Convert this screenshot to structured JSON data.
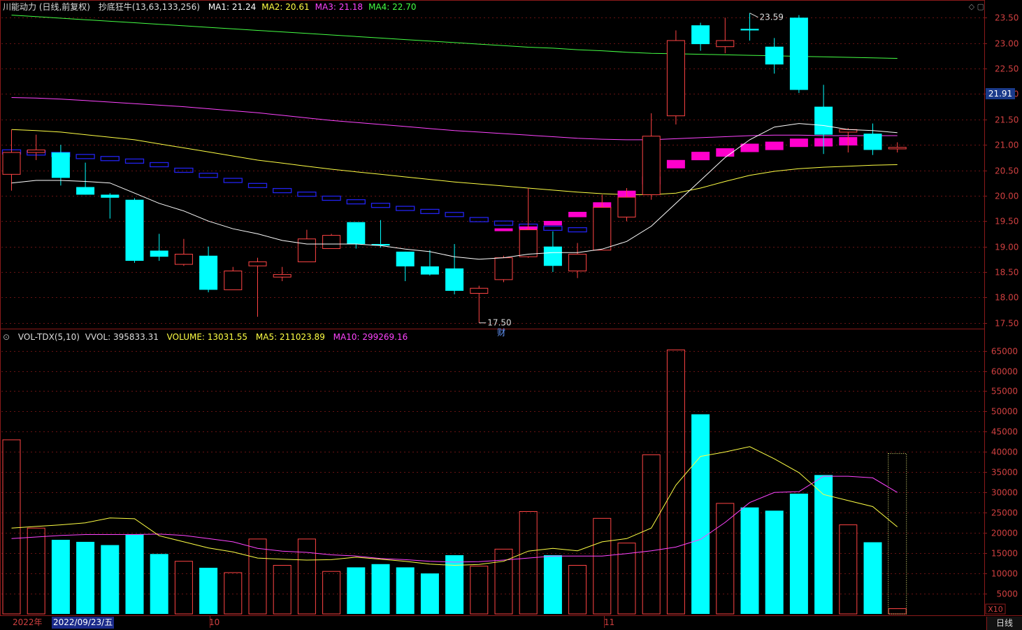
{
  "header": {
    "title": "川能动力 (日线,前复权)",
    "indicator": "抄底狂牛(13,63,133,256)",
    "ma_labels": [
      {
        "text": "MA1: 21.24",
        "color": "#ffffff"
      },
      {
        "text": "MA2: 20.61",
        "color": "#ffff44"
      },
      {
        "text": "MA3: 21.18",
        "color": "#ff44ff"
      },
      {
        "text": "MA4: 22.70",
        "color": "#44ff44"
      }
    ]
  },
  "volume_header": {
    "indicator": "VOL-TDX(5,10)",
    "vvol": "VVOL: 395833.31",
    "volume": "VOLUME: 13031.55",
    "ma5": "MA5: 211023.89",
    "ma10": "MA10: 299269.16"
  },
  "current_price": "21.91",
  "annotations": {
    "high": "23.59",
    "low": "17.50",
    "event": "财"
  },
  "x_labels": {
    "year": "2022年",
    "cursor_date": "2022/09/23/五",
    "oct": "10",
    "nov": "11",
    "period": "日线"
  },
  "vol_scale_tag": "X10",
  "colors": {
    "up": "#ff4444",
    "down": "#00ffff",
    "ma1": "#ffffff",
    "ma2": "#ffff44",
    "ma3": "#ff44ff",
    "ma4": "#44ff44",
    "blue_steps": "#2222ee",
    "magenta_steps": "#ff00cc",
    "grid": "#8b1a1a"
  },
  "chart_data": {
    "type": "candlestick",
    "price_axis": {
      "ticks": [
        17.5,
        18.0,
        18.5,
        19.0,
        19.5,
        20.0,
        20.5,
        21.0,
        21.5,
        22.0,
        22.5,
        23.0,
        23.5
      ],
      "range": [
        17.4,
        23.6
      ]
    },
    "volume_axis": {
      "ticks": [
        5000,
        10000,
        15000,
        20000,
        25000,
        30000,
        35000,
        40000,
        45000,
        50000,
        55000,
        60000,
        65000
      ],
      "range": [
        0,
        67000
      ]
    },
    "candles": [
      {
        "o": 20.42,
        "h": 21.3,
        "l": 20.1,
        "c": 20.85,
        "v": 43000
      },
      {
        "o": 20.85,
        "h": 21.2,
        "l": 20.7,
        "c": 20.9,
        "v": 21200
      },
      {
        "o": 20.85,
        "h": 21.0,
        "l": 20.2,
        "c": 20.35,
        "v": 18300
      },
      {
        "o": 20.17,
        "h": 20.65,
        "l": 20.02,
        "c": 20.02,
        "v": 17800
      },
      {
        "o": 20.02,
        "h": 20.05,
        "l": 19.55,
        "c": 19.96,
        "v": 17000
      },
      {
        "o": 19.92,
        "h": 19.95,
        "l": 18.68,
        "c": 18.72,
        "v": 19700
      },
      {
        "o": 18.92,
        "h": 19.25,
        "l": 18.72,
        "c": 18.8,
        "v": 14800
      },
      {
        "o": 18.65,
        "h": 19.15,
        "l": 18.62,
        "c": 18.85,
        "v": 13000
      },
      {
        "o": 18.82,
        "h": 19.0,
        "l": 18.1,
        "c": 18.15,
        "v": 11400
      },
      {
        "o": 18.15,
        "h": 18.6,
        "l": 18.15,
        "c": 18.52,
        "v": 10200
      },
      {
        "o": 18.62,
        "h": 18.78,
        "l": 17.62,
        "c": 18.7,
        "v": 18500
      },
      {
        "o": 18.4,
        "h": 18.6,
        "l": 18.32,
        "c": 18.45,
        "v": 12000
      },
      {
        "o": 18.7,
        "h": 19.33,
        "l": 18.7,
        "c": 19.15,
        "v": 18500
      },
      {
        "o": 18.96,
        "h": 19.25,
        "l": 18.96,
        "c": 19.22,
        "v": 10500
      },
      {
        "o": 19.48,
        "h": 19.48,
        "l": 18.96,
        "c": 19.05,
        "v": 11500
      },
      {
        "o": 19.05,
        "h": 19.52,
        "l": 18.98,
        "c": 19.02,
        "v": 12300
      },
      {
        "o": 18.9,
        "h": 18.9,
        "l": 18.32,
        "c": 18.61,
        "v": 11500
      },
      {
        "o": 18.61,
        "h": 18.93,
        "l": 18.43,
        "c": 18.45,
        "v": 10000
      },
      {
        "o": 18.57,
        "h": 19.05,
        "l": 18.06,
        "c": 18.13,
        "v": 14500
      },
      {
        "o": 18.08,
        "h": 18.23,
        "l": 17.5,
        "c": 18.18,
        "v": 11800
      },
      {
        "o": 18.35,
        "h": 18.82,
        "l": 18.3,
        "c": 18.78,
        "v": 16000
      },
      {
        "o": 18.8,
        "h": 20.15,
        "l": 18.78,
        "c": 19.33,
        "v": 25300
      },
      {
        "o": 19.0,
        "h": 19.3,
        "l": 18.5,
        "c": 18.62,
        "v": 14500
      },
      {
        "o": 18.52,
        "h": 19.07,
        "l": 18.38,
        "c": 18.85,
        "v": 12000
      },
      {
        "o": 18.93,
        "h": 20.02,
        "l": 18.93,
        "c": 19.77,
        "v": 23600
      },
      {
        "o": 19.58,
        "h": 20.15,
        "l": 19.5,
        "c": 19.97,
        "v": 17500
      },
      {
        "o": 20.02,
        "h": 21.62,
        "l": 19.92,
        "c": 21.17,
        "v": 39300
      },
      {
        "o": 21.57,
        "h": 23.25,
        "l": 21.4,
        "c": 23.05,
        "v": 65200
      },
      {
        "o": 23.35,
        "h": 23.4,
        "l": 22.85,
        "c": 22.98,
        "v": 49300
      },
      {
        "o": 22.93,
        "h": 23.5,
        "l": 22.8,
        "c": 23.05,
        "v": 27300
      },
      {
        "o": 23.28,
        "h": 23.59,
        "l": 23.05,
        "c": 23.25,
        "v": 26300
      },
      {
        "o": 22.93,
        "h": 23.1,
        "l": 22.4,
        "c": 22.58,
        "v": 25500
      },
      {
        "o": 23.5,
        "h": 23.55,
        "l": 22.02,
        "c": 22.08,
        "v": 29700
      },
      {
        "o": 21.75,
        "h": 22.18,
        "l": 20.82,
        "c": 21.2,
        "v": 34300
      },
      {
        "o": 21.25,
        "h": 21.33,
        "l": 20.85,
        "c": 21.3,
        "v": 22000
      },
      {
        "o": 21.22,
        "h": 21.42,
        "l": 20.8,
        "c": 20.9,
        "v": 17700
      },
      {
        "o": 20.92,
        "h": 21.05,
        "l": 20.85,
        "c": 20.95,
        "v": 1300
      }
    ],
    "ma1_line": [
      20.25,
      20.3,
      20.3,
      20.28,
      20.25,
      20.05,
      19.85,
      19.7,
      19.5,
      19.35,
      19.25,
      19.12,
      19.05,
      19.05,
      19.05,
      19.02,
      18.95,
      18.9,
      18.8,
      18.75,
      18.78,
      18.85,
      18.88,
      18.88,
      18.95,
      19.1,
      19.4,
      19.85,
      20.3,
      20.75,
      21.1,
      21.35,
      21.42,
      21.38,
      21.3,
      21.28,
      21.24
    ],
    "ma2_line": [
      21.3,
      21.28,
      21.25,
      21.2,
      21.15,
      21.1,
      21.02,
      20.94,
      20.86,
      20.78,
      20.7,
      20.64,
      20.58,
      20.52,
      20.47,
      20.42,
      20.37,
      20.32,
      20.27,
      20.23,
      20.19,
      20.15,
      20.11,
      20.07,
      20.04,
      20.02,
      20.02,
      20.05,
      20.15,
      20.28,
      20.4,
      20.48,
      20.53,
      20.56,
      20.58,
      20.6,
      20.61
    ],
    "ma3_line": [
      21.93,
      21.92,
      21.9,
      21.87,
      21.84,
      21.81,
      21.78,
      21.75,
      21.71,
      21.67,
      21.63,
      21.58,
      21.53,
      21.48,
      21.44,
      21.4,
      21.36,
      21.32,
      21.28,
      21.25,
      21.22,
      21.19,
      21.16,
      21.13,
      21.11,
      21.1,
      21.1,
      21.12,
      21.14,
      21.16,
      21.18,
      21.19,
      21.19,
      21.18,
      21.18,
      21.18,
      21.18
    ],
    "ma4_line": [
      23.55,
      23.52,
      23.49,
      23.46,
      23.43,
      23.4,
      23.37,
      23.34,
      23.31,
      23.28,
      23.25,
      23.22,
      23.19,
      23.16,
      23.13,
      23.1,
      23.07,
      23.04,
      23.01,
      22.98,
      22.95,
      22.92,
      22.9,
      22.87,
      22.85,
      22.82,
      22.8,
      22.79,
      22.78,
      22.77,
      22.76,
      22.75,
      22.74,
      22.73,
      22.72,
      22.71,
      22.7
    ],
    "blue_steps": [
      20.86,
      20.84,
      20.81,
      20.77,
      20.73,
      20.68,
      20.61,
      20.5,
      20.4,
      20.3,
      20.2,
      20.1,
      20.03,
      19.95,
      19.88,
      19.81,
      19.75,
      19.69,
      19.63,
      19.53,
      19.46,
      19.4,
      19.36,
      19.33
    ],
    "magenta_steps": [
      19.33,
      19.36,
      19.46,
      19.63,
      19.81,
      20.03,
      20.3,
      20.62,
      20.78,
      20.85,
      20.94,
      20.98,
      21.04,
      21.05,
      21.07
    ],
    "vol_ma5": [
      21200,
      21600,
      22000,
      22500,
      23700,
      23500,
      19300,
      17800,
      16300,
      15300,
      13800,
      13500,
      13300,
      13400,
      14000,
      13500,
      13000,
      12300,
      12000,
      12200,
      13000,
      15500,
      16200,
      15600,
      17800,
      18600,
      21200,
      31800,
      38900,
      40000,
      41300,
      38300,
      34900,
      29500,
      28000,
      26500,
      21500
    ],
    "vol_ma10": [
      18600,
      19000,
      19400,
      19600,
      19600,
      19600,
      19700,
      19400,
      18600,
      17800,
      16200,
      15500,
      15200,
      14600,
      14300,
      13700,
      13400,
      13000,
      12800,
      12900,
      13300,
      13800,
      14300,
      14300,
      14300,
      14900,
      15600,
      16500,
      18400,
      22600,
      27500,
      30000,
      30200,
      34000,
      34000,
      33600,
      30000
    ]
  }
}
